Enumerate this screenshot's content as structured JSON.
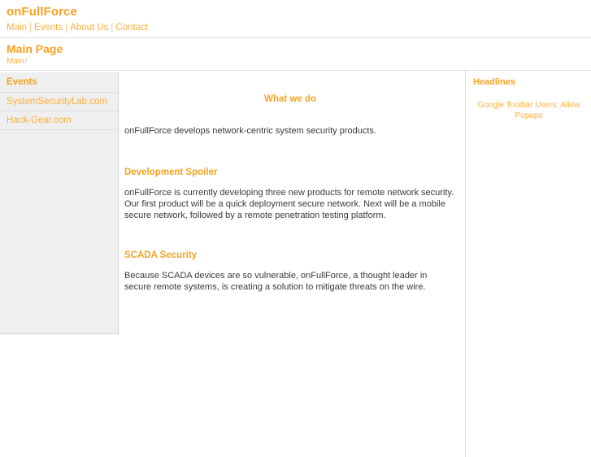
{
  "header": {
    "logo": "onFullForce",
    "nav": [
      {
        "label": "Main"
      },
      {
        "label": "Events"
      },
      {
        "label": "About Us"
      },
      {
        "label": "Contact"
      }
    ],
    "nav_separator": "|"
  },
  "page": {
    "title": "Main Page",
    "breadcrumb_root": "Main",
    "breadcrumb_separator": "/"
  },
  "left_sidebar": {
    "block_title": "Events",
    "links": [
      {
        "label": "SystemSecurityLab.com"
      },
      {
        "label": "Hack-Gear.com"
      }
    ]
  },
  "main": {
    "intro_heading": "What we do",
    "intro_text": "onFullForce develops network-centric system security products.",
    "sections": [
      {
        "heading": "Development Spoiler",
        "text": "onFullForce is currently developing three new products for remote network security. Our first product will be a quick deployment secure network. Next will be a mobile secure network, followed by a remote penetration testing platform."
      },
      {
        "heading": "SCADA Security",
        "text": "Because SCADA devices are so vulnerable, onFullForce, a thought leader in secure remote systems, is creating a solution to mitigate threats on the wire."
      }
    ]
  },
  "right_sidebar": {
    "block_title": "Headlines",
    "headlines": [
      {
        "label": "Google Toolbar Users: Allow Popups"
      }
    ]
  },
  "colors": {
    "accent": "#F7A221",
    "link": "#FBB03B",
    "sidebar_bg": "#efefef",
    "rule": "#dcdcdc",
    "text": "#333333"
  }
}
